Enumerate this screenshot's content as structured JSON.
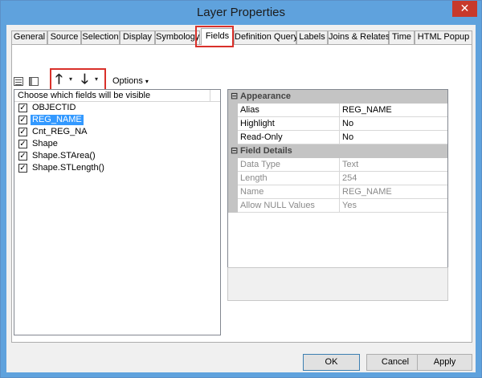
{
  "window": {
    "title": "Layer Properties",
    "close_glyph": "✕"
  },
  "tabs": [
    {
      "label": "General"
    },
    {
      "label": "Source"
    },
    {
      "label": "Selection"
    },
    {
      "label": "Display"
    },
    {
      "label": "Symbology"
    },
    {
      "label": "Fields",
      "active": true
    },
    {
      "label": "Definition Query"
    },
    {
      "label": "Labels"
    },
    {
      "label": "Joins & Relates"
    },
    {
      "label": "Time"
    },
    {
      "label": "HTML Popup"
    }
  ],
  "toolbar": {
    "move_up_glyph": "🡑",
    "move_down_glyph": "🡓",
    "caret_glyph": "▾",
    "options_label": "Options"
  },
  "field_list": {
    "header": "Choose which fields will be visible",
    "check_glyph": "✓",
    "fields": [
      {
        "name": "OBJECTID",
        "checked": true
      },
      {
        "name": "REG_NAME",
        "checked": true,
        "selected": true
      },
      {
        "name": "Cnt_REG_NA",
        "checked": true
      },
      {
        "name": "Shape",
        "checked": true
      },
      {
        "name": "Shape.STArea()",
        "checked": true
      },
      {
        "name": "Shape.STLength()",
        "checked": true
      }
    ]
  },
  "property_grid": {
    "collapse_glyph": "⊟",
    "appearance": {
      "title": "Appearance",
      "rows": [
        {
          "name": "Alias",
          "value": "REG_NAME"
        },
        {
          "name": "Highlight",
          "value": "No"
        },
        {
          "name": "Read-Only",
          "value": "No"
        }
      ]
    },
    "field_details": {
      "title": "Field Details",
      "rows": [
        {
          "name": "Data Type",
          "value": "Text"
        },
        {
          "name": "Length",
          "value": "254"
        },
        {
          "name": "Name",
          "value": "REG_NAME"
        },
        {
          "name": "Allow NULL Values",
          "value": "Yes"
        }
      ]
    }
  },
  "buttons": {
    "ok": "OK",
    "cancel": "Cancel",
    "apply": "Apply"
  },
  "colors": {
    "titlebar": "#5fa2dd",
    "close": "#c7392b",
    "highlight_box": "#d9302a",
    "selection": "#3399ff"
  }
}
